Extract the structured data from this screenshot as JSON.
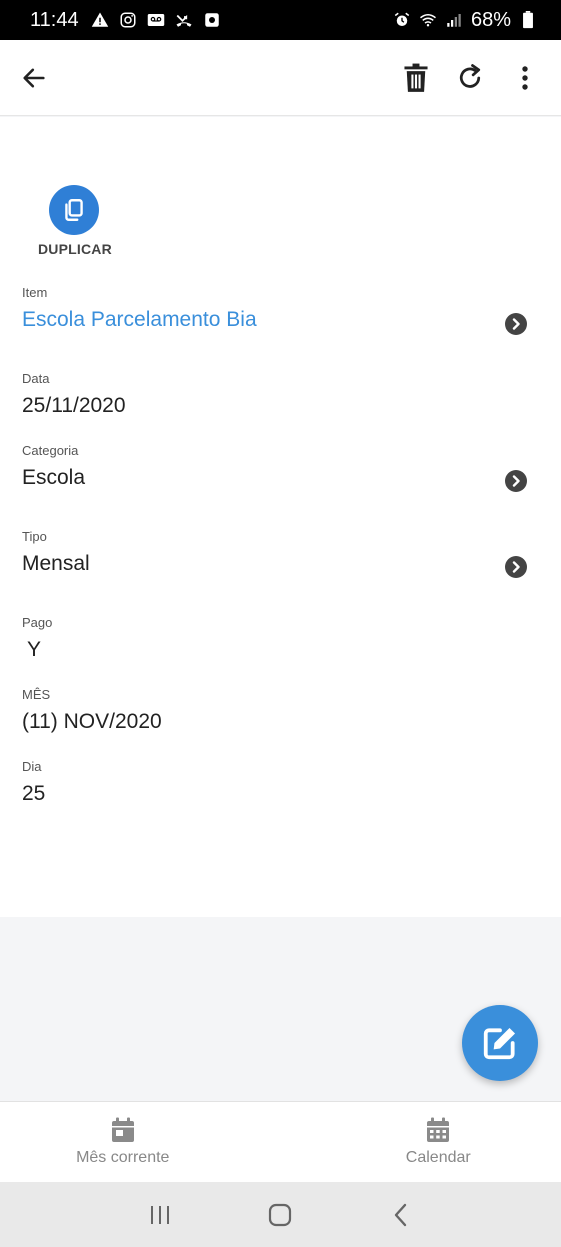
{
  "status_bar": {
    "time": "11:44",
    "battery": "68%"
  },
  "header": {
    "back_icon": "arrow-left-icon",
    "actions": [
      "trash-icon",
      "refresh-icon",
      "more-vertical-icon"
    ]
  },
  "duplicate": {
    "label": "DUPLICAR",
    "icon": "copy-icon"
  },
  "fields": {
    "item": {
      "label": "Item",
      "value": "Escola Parcelamento Bia"
    },
    "data": {
      "label": "Data",
      "value": "25/11/2020"
    },
    "categoria": {
      "label": "Categoria",
      "value": "Escola"
    },
    "tipo": {
      "label": "Tipo",
      "value": "Mensal"
    },
    "pago": {
      "label": "Pago",
      "value": "Y"
    },
    "mes": {
      "label": "MÊS",
      "value": "(11) NOV/2020"
    },
    "dia": {
      "label": "Dia",
      "value": "25"
    }
  },
  "fab": {
    "icon": "edit-icon"
  },
  "bottom_nav": {
    "current_month": "Mês corrente",
    "calendar": "Calendar"
  },
  "colors": {
    "accent": "#3a8fdb",
    "duplicate_button": "#2f7fd6"
  }
}
